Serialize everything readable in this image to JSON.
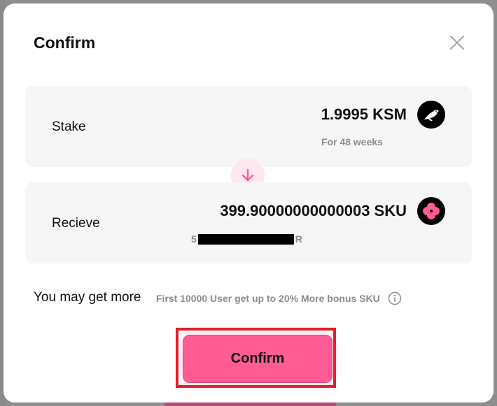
{
  "modal": {
    "title": "Confirm",
    "close_icon": "close-icon"
  },
  "stake": {
    "label": "Stake",
    "amount": "1.9995 KSM",
    "duration": "For 48 weeks",
    "icon": "kusama-bird-icon"
  },
  "receive": {
    "label": "Recieve",
    "amount": "399.90000000000003 SKU",
    "address_prefix": "5",
    "address_suffix": "R",
    "icon": "sku-flower-icon"
  },
  "arrow_icon": "arrow-down-icon",
  "bonus": {
    "title": "You may get more",
    "text": "First 10000 User get up to 20% More bonus SKU",
    "icon": "info-icon"
  },
  "confirm_button": {
    "label": "Confirm"
  },
  "colors": {
    "accent": "#ff5c94",
    "highlight_border": "#e11d2a",
    "card_bg": "#f6f6f6"
  }
}
